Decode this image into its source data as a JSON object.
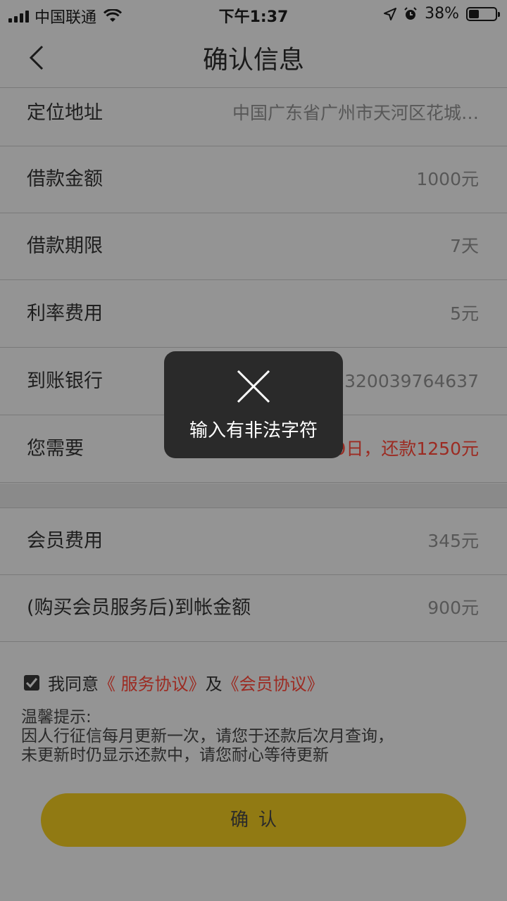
{
  "status_bar": {
    "carrier": "中国联通",
    "time": "下午1:37",
    "battery": "38%",
    "battery_level": 0.38
  },
  "header": {
    "title": "确认信息"
  },
  "rows": [
    {
      "label": "定位地址",
      "value": "中国广东省广州市天河区花城…"
    },
    {
      "label": "借款金额",
      "value": "1000元"
    },
    {
      "label": "借款期限",
      "value": "7天"
    },
    {
      "label": "利率费用",
      "value": "5元"
    },
    {
      "label": "到账银行",
      "value": "3320039764637"
    },
    {
      "label": "您需要",
      "value": "9日，还款1250元"
    }
  ],
  "member_rows": [
    {
      "label": "会员费用",
      "value": "345元"
    },
    {
      "label": "(购买会员服务后)到帐金额",
      "value": "900元"
    }
  ],
  "agreement": {
    "prefix": "我同意",
    "service_link": "《 服务协议》",
    "and": "及",
    "member_link": "《会员协议》",
    "checked": true
  },
  "tips": {
    "title": "温馨提示:",
    "line1": "因人行征信每月更新一次，请您于还款后次月查询，",
    "line2": "未更新时仍显示还款中，请您耐心等待更新"
  },
  "confirm_button": "确认",
  "toast": {
    "icon": "close-icon",
    "message": "输入有非法字符"
  },
  "colors": {
    "overlay_bg": "#949494",
    "accent_red": "#9c2b22",
    "button": "#917a13",
    "toast_bg": "#2a2a2a"
  }
}
